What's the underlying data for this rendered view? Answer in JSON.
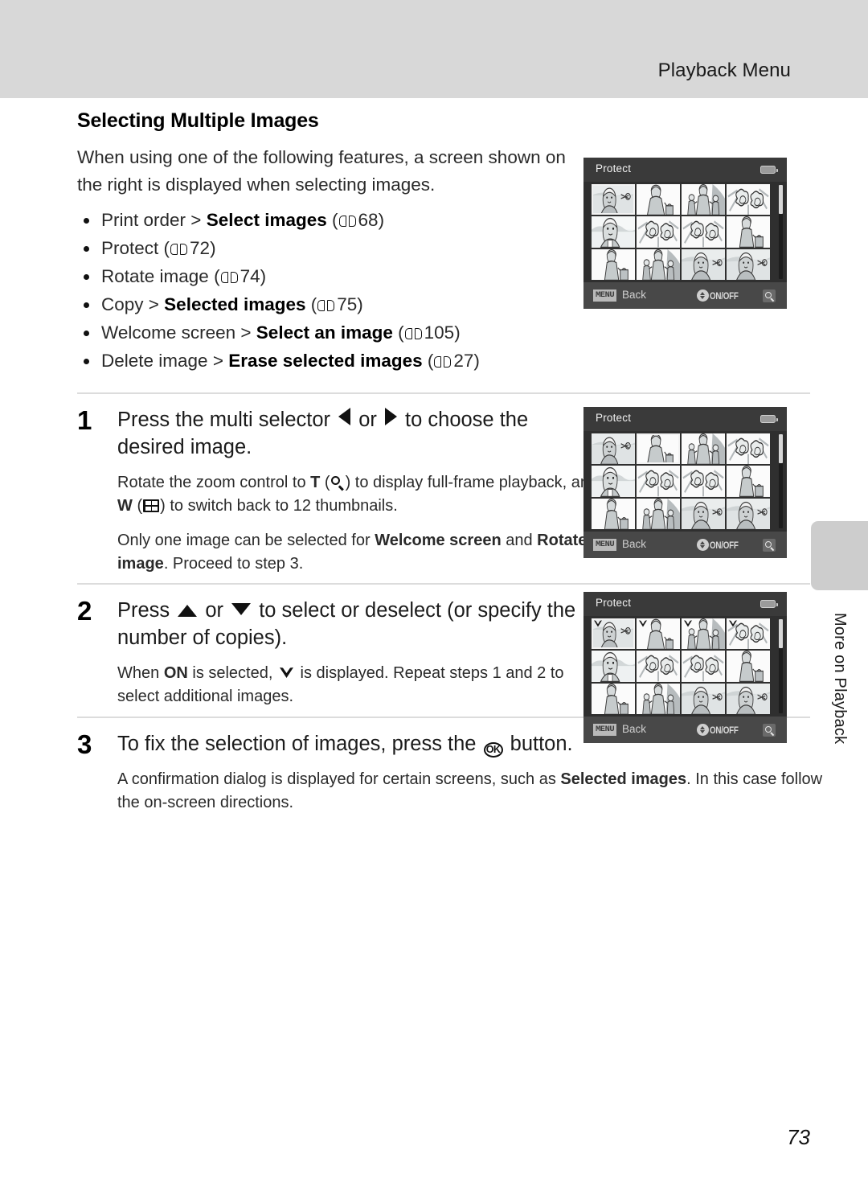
{
  "header": {
    "running_title": "Playback Menu"
  },
  "section": {
    "title": "Selecting Multiple Images",
    "intro": "When using one of the following features, a screen shown on the right is displayed when selecting images."
  },
  "feature_list": [
    {
      "lead": "Print order > ",
      "bold": "Select images",
      "page_ref": "68"
    },
    {
      "lead": "Protect ",
      "bold": "",
      "page_ref": "72"
    },
    {
      "lead": "Rotate image ",
      "bold": "",
      "page_ref": "74"
    },
    {
      "lead": "Copy > ",
      "bold": "Selected images",
      "page_ref": "75"
    },
    {
      "lead": "Welcome screen > ",
      "bold": "Select an image",
      "page_ref": "105"
    },
    {
      "lead": "Delete image > ",
      "bold": "Erase selected images",
      "page_ref": "27"
    }
  ],
  "steps": [
    {
      "number": "1",
      "head_a": "Press the multi selector ",
      "head_b": " or ",
      "head_c": " to choose the desired image.",
      "sub1_a": "Rotate the zoom control to ",
      "sub1_t": "T",
      "sub1_b": " (",
      "sub1_c": ") to display full-frame playback, and ",
      "sub1_w": "W",
      "sub1_d": " (",
      "sub1_e": ") to switch back to 12 thumbnails.",
      "sub2_a": "Only one image can be selected for ",
      "sub2_bold1": "Welcome screen",
      "sub2_b": " and ",
      "sub2_bold2": "Rotate image",
      "sub2_c": ". Proceed to step 3."
    },
    {
      "number": "2",
      "head_a": "Press ",
      "head_b": " or ",
      "head_c": " to select or deselect (or specify the number of copies).",
      "sub1_a": "When ",
      "sub1_bold": "ON",
      "sub1_b": " is selected, ",
      "sub1_c": " is displayed. Repeat steps 1 and 2 to select additional images."
    },
    {
      "number": "3",
      "head_a": "To fix the selection of images, press the ",
      "head_ok": "OK",
      "head_c": " button.",
      "sub1_a": "A confirmation dialog is displayed for certain screens, such as ",
      "sub1_bold": "Selected images",
      "sub1_b": ". In this case follow the on-screen directions."
    }
  ],
  "camera_screens": [
    {
      "id": "screen-overview",
      "title": "Protect",
      "menu_chip": "MENU",
      "back_label": "Back",
      "onoff_label": "ON/OFF",
      "selected_index": 0,
      "checked_indices": []
    },
    {
      "id": "screen-step1",
      "title": "Protect",
      "menu_chip": "MENU",
      "back_label": "Back",
      "onoff_label": "ON/OFF",
      "selected_index": 1,
      "checked_indices": []
    },
    {
      "id": "screen-step2",
      "title": "Protect",
      "menu_chip": "MENU",
      "back_label": "Back",
      "onoff_label": "ON/OFF",
      "selected_index": 0,
      "checked_indices": [
        0,
        1,
        2,
        3
      ]
    }
  ],
  "side_tab": {
    "label": "More on Playback"
  },
  "footer": {
    "page_number": "73"
  }
}
